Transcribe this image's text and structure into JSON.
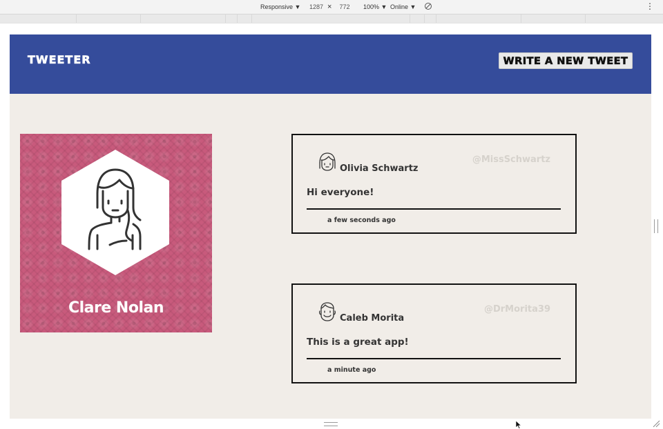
{
  "devtools": {
    "device": "Responsive ▼",
    "width": "1287",
    "times": "×",
    "height": "772",
    "zoom": "100% ▼",
    "network": "Online ▼",
    "menu": "⋮"
  },
  "nav": {
    "brand": "TWEETER",
    "compose_label": "WRITE A NEW TWEET"
  },
  "profile": {
    "name": "Clare Nolan",
    "background_color": "#c85a7c"
  },
  "tweets": [
    {
      "author": "Olivia Schwartz",
      "handle": "@MissSchwartz",
      "content": "Hi everyone!",
      "time": "a few seconds ago",
      "avatar_icon": "woman-face-icon"
    },
    {
      "author": "Caleb Morita",
      "handle": "@DrMorita39",
      "content": "This is a great app!",
      "time": "a minute ago",
      "avatar_icon": "man-face-icon"
    }
  ],
  "colors": {
    "nav_bg": "#354c9b",
    "page_bg": "#f1ede8",
    "handle": "#d6d2cc"
  }
}
